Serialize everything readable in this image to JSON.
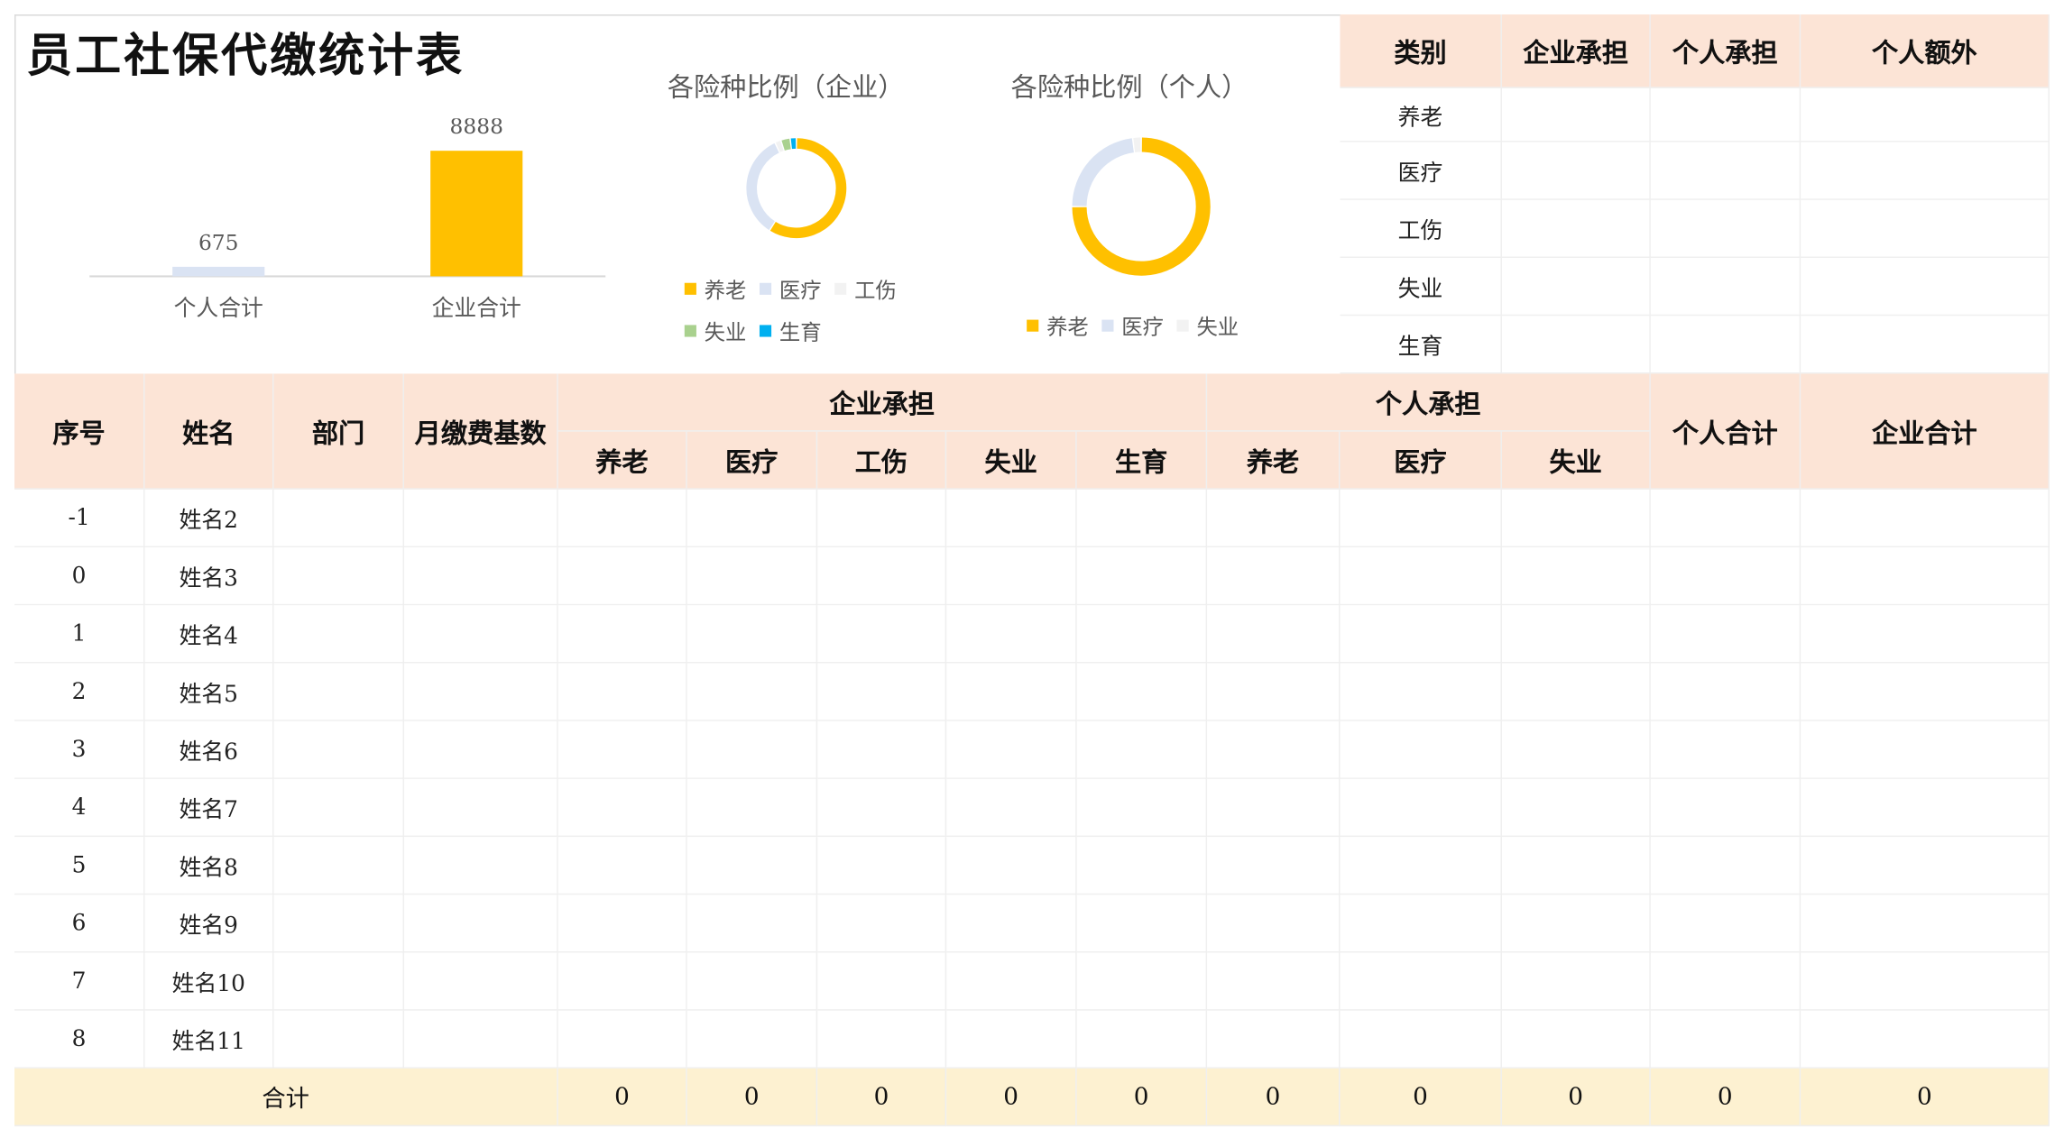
{
  "title": "员工社保代缴统计表",
  "colors": {
    "yellow": "#FFC000",
    "light_blue": "#DAE3F3",
    "light_gray": "#F2F2F2",
    "green": "#A9D18E",
    "blue": "#00B0F0",
    "header_bg": "#FCE4D6",
    "total_bg": "#FDF1D1"
  },
  "chart_data": [
    {
      "type": "bar",
      "title": "",
      "categories": [
        "个人合计",
        "企业合计"
      ],
      "values": [
        675,
        8888
      ],
      "data_labels": [
        "675",
        "8888"
      ],
      "colors": [
        "#DAE3F3",
        "#FFC000"
      ],
      "ylim": [
        0,
        9500
      ],
      "grid": false
    },
    {
      "type": "pie",
      "title": "各险种比例（企业）",
      "donut": true,
      "labels": [
        "养老",
        "医疗",
        "工伤",
        "失业",
        "生育"
      ],
      "values": [
        59,
        34,
        2,
        3,
        2
      ],
      "colors": [
        "#FFC000",
        "#DAE3F3",
        "#F2F2F2",
        "#A9D18E",
        "#00B0F0"
      ],
      "legend": "bottom"
    },
    {
      "type": "pie",
      "title": "各险种比例（个人）",
      "donut": true,
      "labels": [
        "养老",
        "医疗",
        "失业"
      ],
      "values": [
        75,
        23,
        2
      ],
      "colors": [
        "#FFC000",
        "#DAE3F3",
        "#F2F2F2"
      ],
      "legend": "bottom"
    }
  ],
  "rate_table": {
    "headers": [
      "类别",
      "企业承担",
      "个人承担",
      "个人额外"
    ],
    "rows": [
      {
        "category": "养老",
        "company": "",
        "personal": "",
        "extra": ""
      },
      {
        "category": "医疗",
        "company": "",
        "personal": "",
        "extra": ""
      },
      {
        "category": "工伤",
        "company": "",
        "personal": "",
        "extra": ""
      },
      {
        "category": "失业",
        "company": "",
        "personal": "",
        "extra": ""
      },
      {
        "category": "生育",
        "company": "",
        "personal": "",
        "extra": ""
      }
    ]
  },
  "main_table": {
    "headers": {
      "seq": "序号",
      "name": "姓名",
      "dept": "部门",
      "base": "月缴费基数",
      "company_group": "企业承担",
      "personal_group": "个人承担",
      "personal_total": "个人合计",
      "company_total": "企业合计"
    },
    "company_sub": [
      "养老",
      "医疗",
      "工伤",
      "失业",
      "生育"
    ],
    "personal_sub": [
      "养老",
      "医疗",
      "失业"
    ],
    "rows": [
      {
        "seq": "-1",
        "name": "姓名2"
      },
      {
        "seq": "0",
        "name": "姓名3"
      },
      {
        "seq": "1",
        "name": "姓名4"
      },
      {
        "seq": "2",
        "name": "姓名5"
      },
      {
        "seq": "3",
        "name": "姓名6"
      },
      {
        "seq": "4",
        "name": "姓名7"
      },
      {
        "seq": "5",
        "name": "姓名8"
      },
      {
        "seq": "6",
        "name": "姓名9"
      },
      {
        "seq": "7",
        "name": "姓名10"
      },
      {
        "seq": "8",
        "name": "姓名11"
      }
    ],
    "total": {
      "label": "合计",
      "values": [
        "0",
        "0",
        "0",
        "0",
        "0",
        "0",
        "0",
        "0",
        "0",
        "0"
      ]
    }
  }
}
